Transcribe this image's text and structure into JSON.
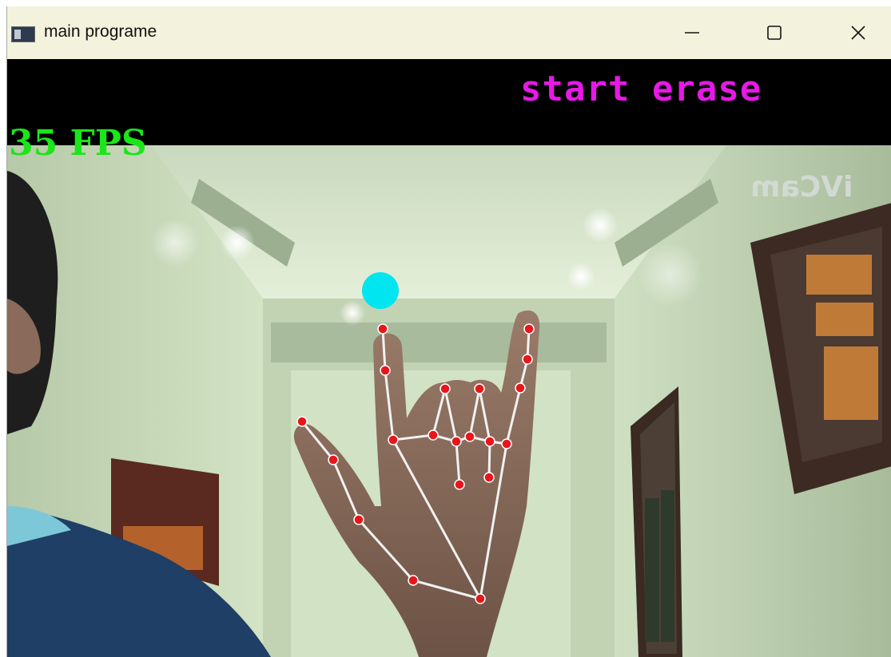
{
  "window": {
    "title": "main programe",
    "controls": {
      "minimize": "minimize-icon",
      "maximize": "maximize-icon",
      "close": "close-icon"
    }
  },
  "overlay": {
    "status": "start erase",
    "fps": "35 FPS",
    "watermark": "iVCam"
  },
  "colors": {
    "status": "#e619e6",
    "fps": "#1ae61a",
    "pointer": "#00e5f0",
    "landmark": "#e8161b",
    "skeleton": "#f2f2f2",
    "titlebar": "#f3f3dd"
  }
}
